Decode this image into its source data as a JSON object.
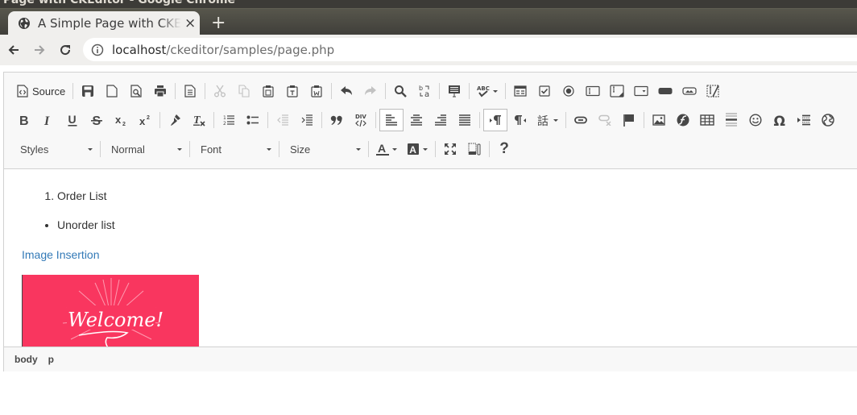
{
  "window": {
    "title": "Page with CKEditor - Google Chrome"
  },
  "tab": {
    "title": "A Simple Page with CKEditor",
    "close": "×",
    "new_tab": "+"
  },
  "omnibox": {
    "host": "localhost",
    "path": "/ckeditor/samples/page.php"
  },
  "toolbar": {
    "source_label": "Source",
    "styles_label": "Styles",
    "format_label": "Normal",
    "font_label": "Font",
    "size_label": "Size",
    "about_label": "?"
  },
  "content": {
    "ordered_list": [
      "Order List"
    ],
    "unordered_list": [
      "Unorder list"
    ],
    "link_text": "Image Insertion",
    "image_text": "Welcome!"
  },
  "elements_path": [
    "body",
    "p"
  ],
  "colors": {
    "image_bg": "#f9365f",
    "link": "#337ab7"
  }
}
